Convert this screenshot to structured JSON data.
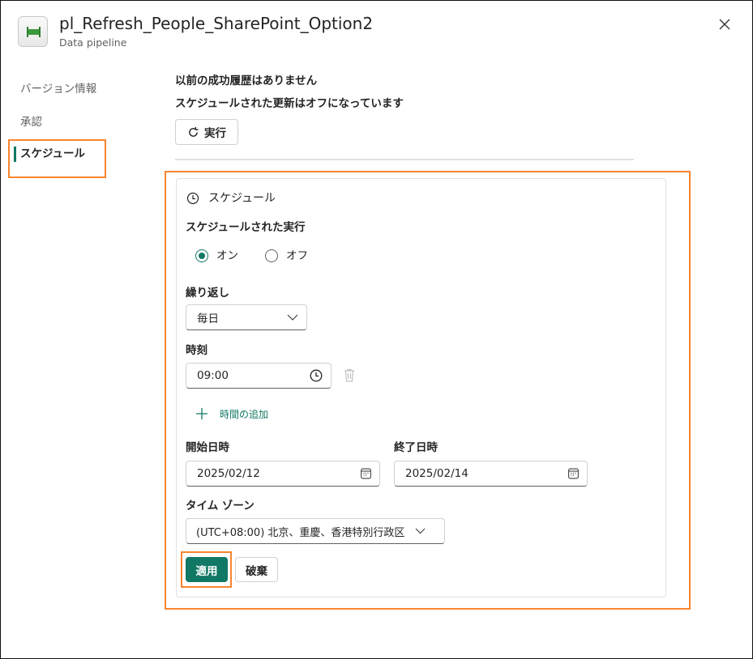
{
  "header": {
    "title": "pl_Refresh_People_SharePoint_Option2",
    "subtitle": "Data pipeline",
    "icon": "pipeline-icon",
    "close_icon": "close-icon"
  },
  "sidebar": {
    "items": [
      {
        "label": "バージョン情報"
      },
      {
        "label": "承認"
      },
      {
        "label": "スケジュール",
        "active": true
      }
    ]
  },
  "status": {
    "history": "以前の成功履歴はありません",
    "refresh_state": "スケジュールされた更新はオフになっています",
    "run_label": "実行"
  },
  "schedule": {
    "title": "スケジュール",
    "scheduled_run_label": "スケジュールされた実行",
    "on_label": "オン",
    "off_label": "オフ",
    "selected": "オン",
    "repeat_label": "繰り返し",
    "repeat_value": "毎日",
    "time_label": "時刻",
    "time_value": "09:00",
    "add_time_label": "時間の追加",
    "start_label": "開始日時",
    "start_value": "2025/02/12",
    "end_label": "終了日時",
    "end_value": "2025/02/14",
    "timezone_label": "タイム ゾーン",
    "timezone_value": "(UTC+08:00) 北京、重慶、香港特別行政区",
    "apply_label": "適用",
    "discard_label": "破棄"
  },
  "colors": {
    "accent": "#117865",
    "highlight": "#f7852e"
  }
}
